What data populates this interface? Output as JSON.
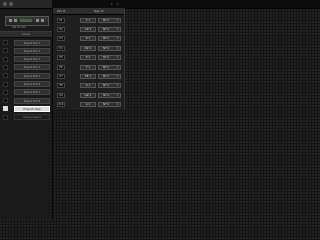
{
  "left_panel": {
    "device_caption": "GM Drums",
    "section_label": "Global",
    "presets": [
      {
        "label": "Preset Slot 1",
        "selected": false
      },
      {
        "label": "Preset Slot 2",
        "selected": false
      },
      {
        "label": "Preset Slot 3",
        "selected": false
      },
      {
        "label": "Preset Slot 4",
        "selected": false
      },
      {
        "label": "Preset Slot 5",
        "selected": false
      },
      {
        "label": "Preset Slot 6",
        "selected": false
      },
      {
        "label": "Preset Slot 7",
        "selected": false
      },
      {
        "label": "Preset Slot 8",
        "selected": false
      },
      {
        "label": "Program Map",
        "selected": true
      },
      {
        "label": "Factory Reset",
        "selected": false
      }
    ]
  },
  "topbar": {
    "prev": "‹",
    "next": "›"
  },
  "table": {
    "headers": {
      "pad": "Pad #",
      "map": "Map To"
    },
    "rows": [
      {
        "pad": "P1",
        "note": "C 1",
        "value": "NT 0"
      },
      {
        "pad": "P2",
        "note": "C# 1",
        "value": "NT 0"
      },
      {
        "pad": "P3",
        "note": "D 1",
        "value": "NT 0"
      },
      {
        "pad": "P4",
        "note": "D# 1",
        "value": "NT 0"
      },
      {
        "pad": "P5",
        "note": "E 1",
        "value": "NT 0"
      },
      {
        "pad": "P6",
        "note": "F 1",
        "value": "NT 0"
      },
      {
        "pad": "P7",
        "note": "F# 1",
        "value": "NT 0"
      },
      {
        "pad": "P8",
        "note": "G 1",
        "value": "NT 0"
      },
      {
        "pad": "P9",
        "note": "G# 1",
        "value": "NT 0"
      },
      {
        "pad": "P10",
        "note": "A 1",
        "value": "NT 0"
      }
    ]
  }
}
